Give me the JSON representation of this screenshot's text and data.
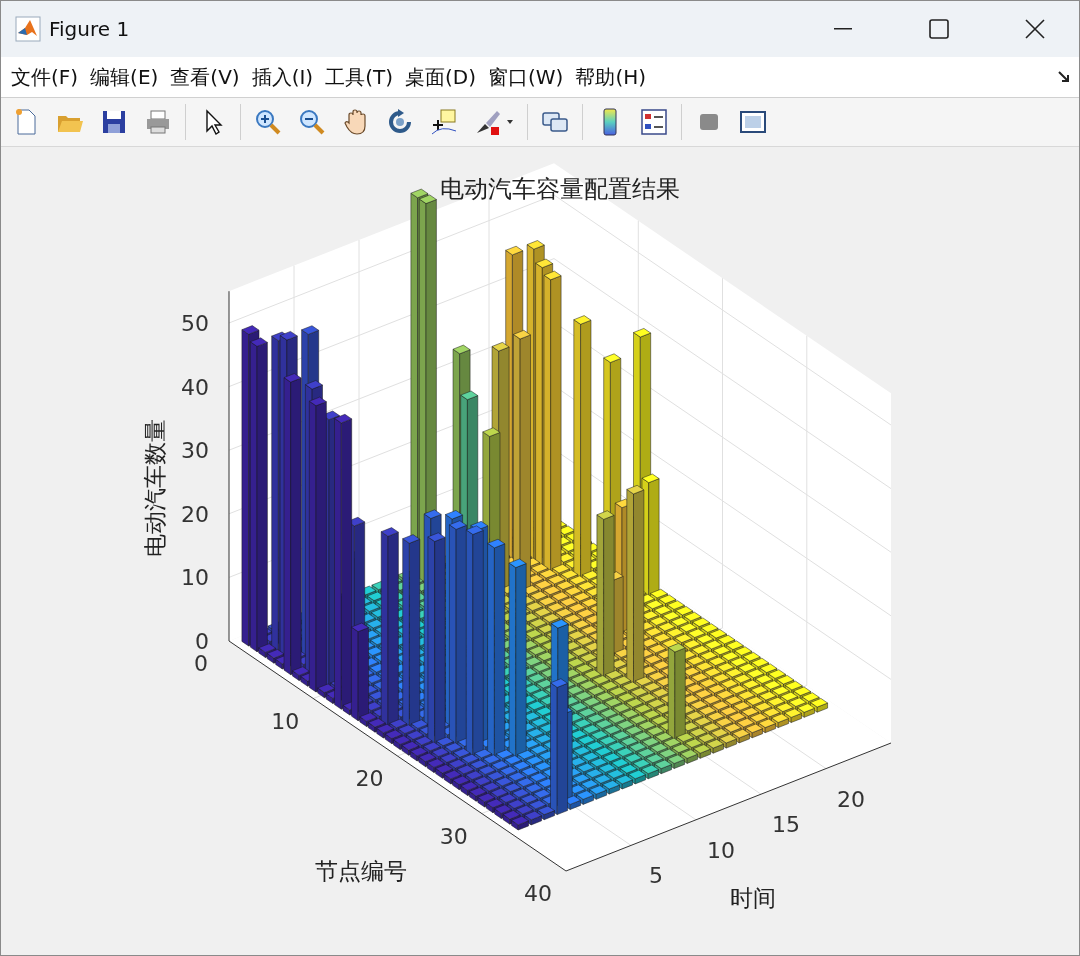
{
  "window": {
    "title": "Figure 1"
  },
  "menu": [
    "文件(F)",
    "编辑(E)",
    "查看(V)",
    "插入(I)",
    "工具(T)",
    "桌面(D)",
    "窗口(W)",
    "帮助(H)"
  ],
  "figure": {
    "title": "电动汽车容量配置结果",
    "zlabel": "电动汽车数量",
    "xlabel": "节点编号",
    "ylabel": "时间",
    "zticks": [
      "50",
      "40",
      "30",
      "20",
      "10",
      "0"
    ],
    "node_ticks": [
      "0",
      "10",
      "20",
      "30",
      "40"
    ],
    "time_ticks": [
      "5",
      "10",
      "15",
      "20"
    ]
  }
}
